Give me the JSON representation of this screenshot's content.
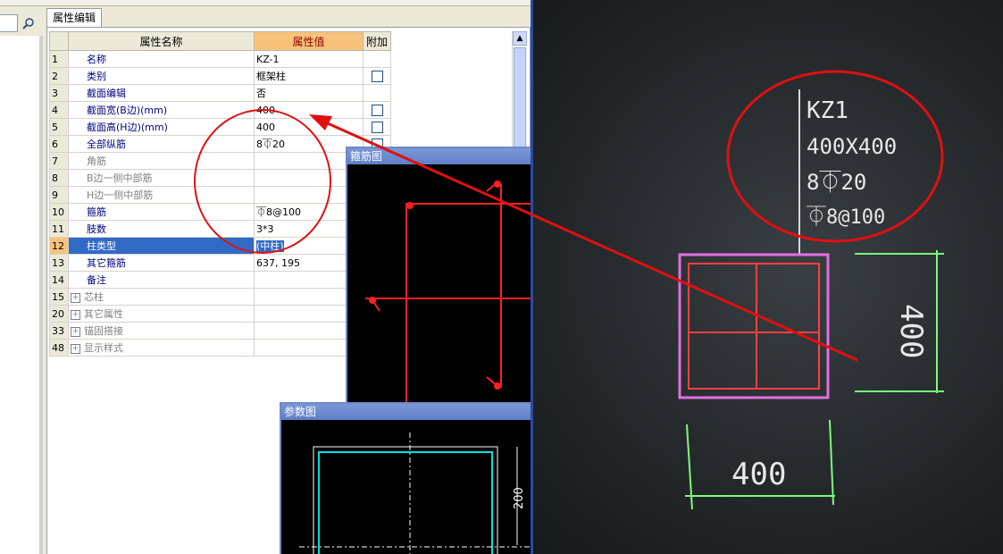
{
  "tab": {
    "label": "属性编辑"
  },
  "grid": {
    "headers": {
      "name": "属性名称",
      "value": "属性值",
      "extra": "附加"
    },
    "rows": [
      {
        "num": "1",
        "name": "名称",
        "value": "KZ-1",
        "cb": false,
        "style": "blue"
      },
      {
        "num": "2",
        "name": "类别",
        "value": "框架柱",
        "cb": true,
        "style": "blue"
      },
      {
        "num": "3",
        "name": "截面编辑",
        "value": "否",
        "cb": false,
        "style": "blue"
      },
      {
        "num": "4",
        "name": "截面宽(B边)(mm)",
        "value": "400",
        "cb": true,
        "style": "blue"
      },
      {
        "num": "5",
        "name": "截面高(H边)(mm)",
        "value": "400",
        "cb": true,
        "style": "blue"
      },
      {
        "num": "6",
        "name": "全部纵筋",
        "value": "8⏁20",
        "cb": true,
        "style": "blue"
      },
      {
        "num": "7",
        "name": "角筋",
        "value": "",
        "cb": false,
        "style": "gray"
      },
      {
        "num": "8",
        "name": "B边一侧中部筋",
        "value": "",
        "cb": false,
        "style": "gray"
      },
      {
        "num": "9",
        "name": "H边一侧中部筋",
        "value": "",
        "cb": false,
        "style": "gray"
      },
      {
        "num": "10",
        "name": "箍筋",
        "value": "⏁8@100",
        "cb": false,
        "style": "blue"
      },
      {
        "num": "11",
        "name": "肢数",
        "value": "3*3",
        "cb": false,
        "style": "blue"
      },
      {
        "num": "12",
        "name": "柱类型",
        "value": "(中柱)",
        "cb": false,
        "style": "sel"
      },
      {
        "num": "13",
        "name": "其它箍筋",
        "value": "637, 195",
        "cb": false,
        "style": "blue"
      },
      {
        "num": "14",
        "name": "备注",
        "value": "",
        "cb": false,
        "style": "blue"
      },
      {
        "num": "15",
        "name": "芯柱",
        "value": "",
        "cb": false,
        "style": "group"
      },
      {
        "num": "20",
        "name": "其它属性",
        "value": "",
        "cb": false,
        "style": "group"
      },
      {
        "num": "33",
        "name": "锚固搭接",
        "value": "",
        "cb": false,
        "style": "group"
      },
      {
        "num": "48",
        "name": "显示样式",
        "value": "",
        "cb": false,
        "style": "group"
      }
    ]
  },
  "stirrup_window": {
    "title": "箍筋图"
  },
  "param_window": {
    "title": "参数图",
    "dim_label": "200"
  },
  "photo": {
    "annotation_lines": [
      "KZ1",
      "400X400",
      "8⏁20",
      "⏁8@100"
    ],
    "dim_right": "400",
    "dim_bottom": "400"
  },
  "colors": {
    "annotation_red": "#e01010",
    "rebar_red": "#ff2020",
    "cyan": "#00e0e0",
    "green": "#7cfc7c",
    "column_pink": "#e070e0"
  }
}
